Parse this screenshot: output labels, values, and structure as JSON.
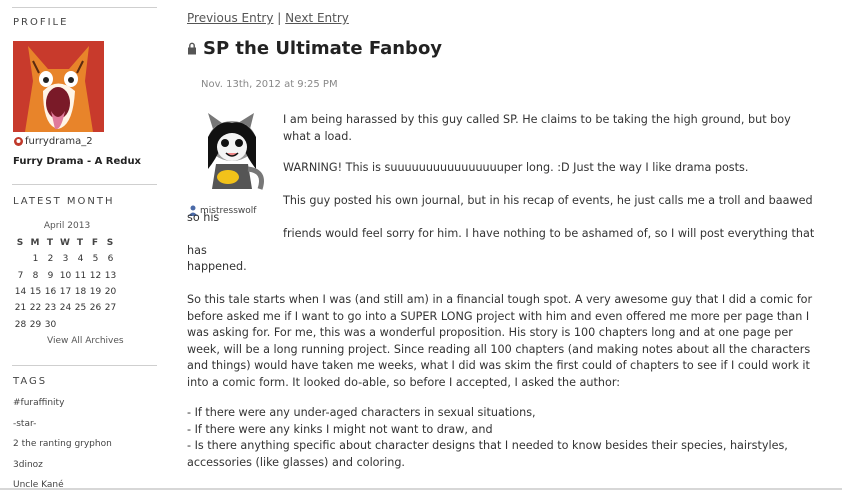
{
  "sidebar": {
    "profile_heading": "PROFILE",
    "username": "furrydrama_2",
    "journal_name": "Furry Drama - A Redux",
    "latest_month_heading": "LATEST MONTH",
    "calendar": {
      "month_label": "April 2013",
      "weekday_headers": [
        "S",
        "M",
        "T",
        "W",
        "T",
        "F",
        "S"
      ],
      "weeks": [
        [
          "",
          "1",
          "2",
          "3",
          "4",
          "5",
          "6"
        ],
        [
          "7",
          "8",
          "9",
          "10",
          "11",
          "12",
          "13"
        ],
        [
          "14",
          "15",
          "16",
          "17",
          "18",
          "19",
          "20"
        ],
        [
          "21",
          "22",
          "23",
          "24",
          "25",
          "26",
          "27"
        ],
        [
          "28",
          "29",
          "30",
          "",
          "",
          "",
          ""
        ]
      ]
    },
    "view_all_archives": "View All Archives",
    "tags_heading": "TAGS",
    "tags": [
      "#furaffinity",
      "-star-",
      "2 the ranting gryphon",
      "3dinoz",
      "Uncle Kané"
    ]
  },
  "entry": {
    "nav_prev": "Previous Entry",
    "nav_sep": "|",
    "nav_next": "Next Entry",
    "title": "SP the Ultimate Fanboy",
    "date": "Nov. 13th, 2012 at 9:25 PM",
    "poster_name": "mistresswolf",
    "p1": "I am being harassed by this guy called SP. He claims to be taking the high ground, but boy what a load.",
    "p2": "WARNING! This is suuuuuuuuuuuuuuuuper long. :D Just the way I like drama posts.",
    "p3_line1": "This guy posted his own journal, but in his recap of events, he just calls me a troll and baawed so his",
    "p3_line2": "friends would feel sorry for him. I have nothing to be ashamed of, so I will post everything that has",
    "p3_line3": "happened.",
    "p4": "So this tale starts when I was (and still am) in a financial tough spot. A very awesome guy that I did a comic for before asked me if I want to go into a SUPER LONG project with him and even offered me more per page than I was asking for. For me, this was a wonderful proposition. His story is 100 chapters long and at one page per week, will be a long running project. Since reading all 100 chapters (and making notes about all the characters and things) would have taken me weeks, what I did was skim the first could of chapters to see if I could work it into a comic form. It looked do-able, so before I accepted, I asked the author:",
    "list": [
      "- If there were any under-aged characters in sexual situations,",
      "- If there were any kinks I might not want to draw, and",
      "- Is there anything specific about character designs that I needed to know besides their species, hairstyles, accessories (like glasses) and coloring."
    ]
  }
}
